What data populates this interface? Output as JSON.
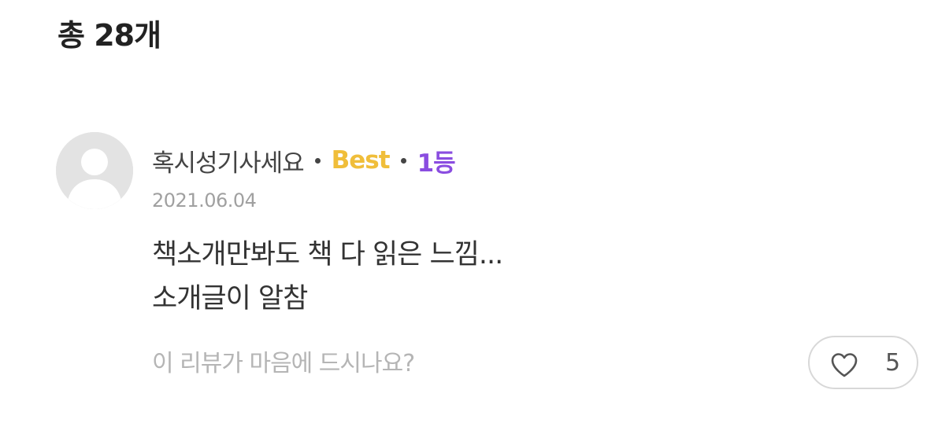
{
  "header": {
    "total_count": "총 28개"
  },
  "review": {
    "avatar_icon": "default-user-avatar-icon",
    "nickname": "혹시성기사세요",
    "best_label": "Best",
    "rank_label": "1등",
    "date": "2021.06.04",
    "text_lines": [
      "책소개만봐도 책 다 읽은 느낌...",
      "소개글이 알참"
    ],
    "like_prompt": "이 리뷰가 마음에 드시나요?",
    "like_icon": "heart-icon",
    "like_count": "5"
  },
  "colors": {
    "best": "#f0be3a",
    "rank": "#8a4de0",
    "muted": "#a0a0a0"
  }
}
